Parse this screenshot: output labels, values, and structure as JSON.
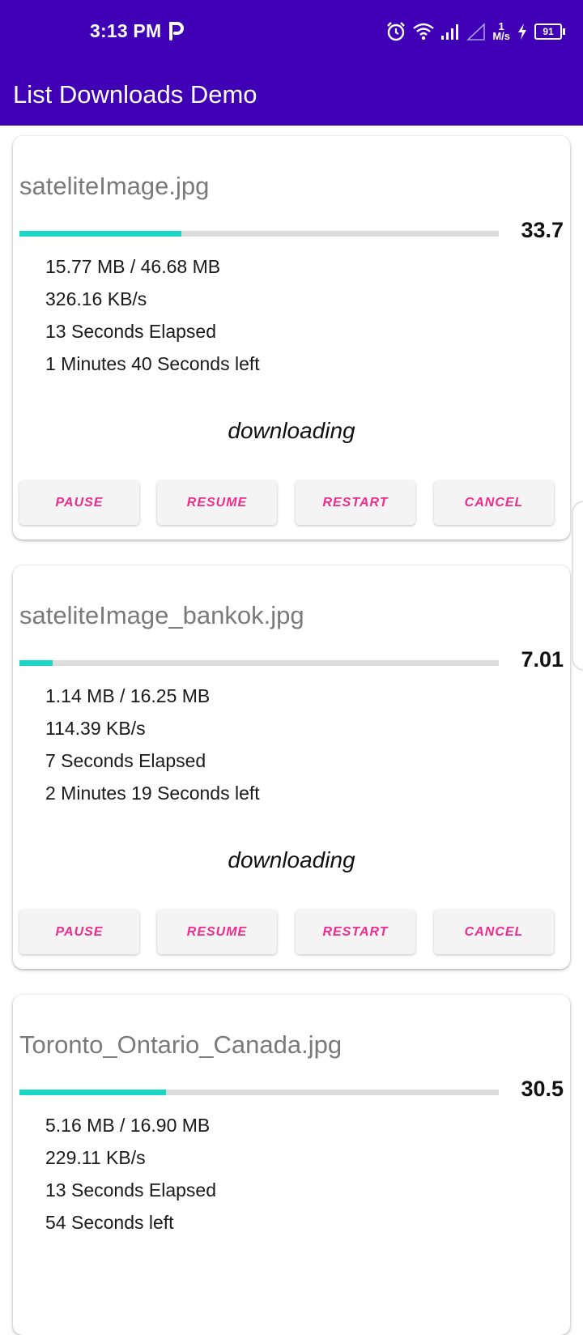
{
  "status_bar": {
    "time": "3:13 PM",
    "speed_value": "1",
    "speed_unit": "M/s",
    "battery": "91",
    "icons": [
      "parking-icon",
      "alarm-icon",
      "wifi-icon",
      "signal-icon",
      "signal-empty-icon",
      "charging-icon",
      "battery-icon"
    ]
  },
  "app_bar": {
    "title": "List Downloads Demo"
  },
  "colors": {
    "primary": "#3f00b6",
    "progress": "#1ad6c5",
    "button_text": "#ee2c8b"
  },
  "buttons": {
    "pause": "PAUSE",
    "resume": "RESUME",
    "restart": "RESTART",
    "cancel": "CANCEL"
  },
  "downloads": [
    {
      "file_name": "sateliteImage.jpg",
      "progress_label": "33.7",
      "progress_percent": 33.7,
      "size": "15.77 MB / 46.68 MB",
      "speed": "326.16 KB/s",
      "elapsed": "13 Seconds Elapsed",
      "remaining": "1 Minutes 40 Seconds left",
      "state": "downloading"
    },
    {
      "file_name": "sateliteImage_bankok.jpg",
      "progress_label": "7.01",
      "progress_percent": 7.01,
      "size": "1.14 MB / 16.25 MB",
      "speed": "114.39 KB/s",
      "elapsed": "7 Seconds Elapsed",
      "remaining": "2 Minutes 19 Seconds left",
      "state": "downloading"
    },
    {
      "file_name": "Toronto_Ontario_Canada.jpg",
      "progress_label": "30.5",
      "progress_percent": 30.5,
      "size": "5.16 MB / 16.90 MB",
      "speed": "229.11 KB/s",
      "elapsed": "13 Seconds Elapsed",
      "remaining": "54 Seconds left",
      "state": ""
    }
  ]
}
